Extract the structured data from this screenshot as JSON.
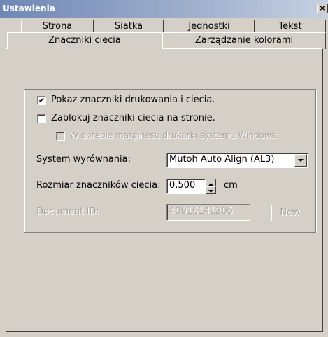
{
  "window": {
    "title": "Ustawienia",
    "close_label": "×"
  },
  "tabs": {
    "row1": [
      "Strona",
      "Siatka",
      "Jednostki",
      "Tekst"
    ],
    "row2": [
      "Znaczniki ciecia",
      "Zarządzanie kolorami"
    ],
    "active": "Znaczniki ciecia"
  },
  "options": {
    "show_marks": {
      "label": "Pokaz znaczniki drukowania i ciecia.",
      "checked": true
    },
    "lock_marks": {
      "label": "Zablokuj znaczniki ciecia na stronie.",
      "checked": false
    },
    "windows_margin": {
      "label": "W obrębie marginesu drukarki systemu Windows.",
      "checked": false,
      "enabled": false
    }
  },
  "alignment": {
    "label": "System wyrównania:",
    "value": "Mutoh Auto Align (AL3)"
  },
  "mark_size": {
    "label": "Rozmiar znaczników ciecia:",
    "value": "0.500",
    "unit": "cm"
  },
  "document_id": {
    "label": "Document ID:",
    "value": "40016141205",
    "new_button": "New"
  }
}
